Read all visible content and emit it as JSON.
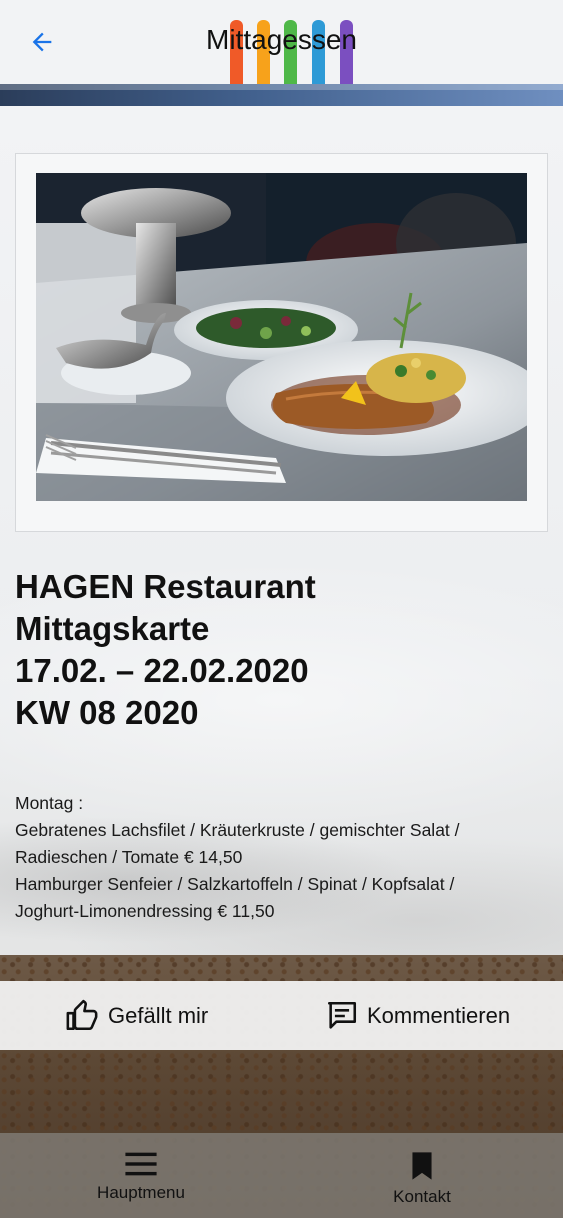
{
  "header": {
    "title": "Mittagessen",
    "back_icon": "arrow-left-icon",
    "accent_color": "#1a73e8",
    "logo_bar_colors": [
      "#f05a28",
      "#f7a21b",
      "#4fb848",
      "#2e9ad6",
      "#7b4fc0"
    ]
  },
  "headline": {
    "line1": "HAGEN Restaurant",
    "line2": "Mittagskarte",
    "line3": "17.02. – 22.02.2020",
    "line4": "KW 08 2020"
  },
  "menu": {
    "day": "Montag :",
    "item1_line1": "Gebratenes Lachsfilet / Kräuterkruste / gemischter Salat /",
    "item1_line2": "Radieschen / Tomate € 14,50",
    "item2_line1": "Hamburger Senfeier / Salzkartoffeln / Spinat / Kopfsalat /",
    "item2_line2": "Joghurt-Limonendressing € 11,50"
  },
  "actions": {
    "like_label": "Gefällt mir",
    "like_icon": "thumbs-up-icon",
    "comment_label": "Kommentieren",
    "comment_icon": "comment-icon"
  },
  "bottom_nav": {
    "menu_label": "Hauptmenu",
    "menu_icon": "hamburger-menu-icon",
    "contact_label": "Kontakt",
    "contact_icon": "bookmark-icon"
  }
}
